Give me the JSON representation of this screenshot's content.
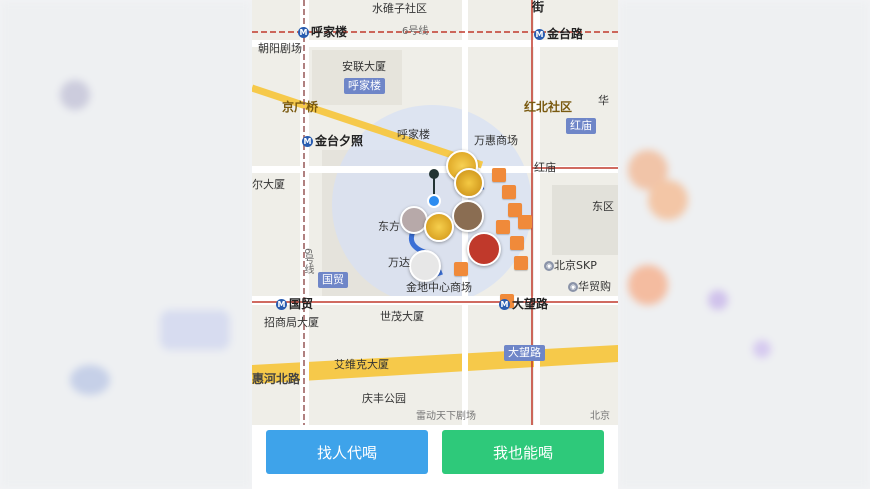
{
  "map": {
    "road_labels": {
      "line6": "6号线",
      "jie": "街",
      "line6_vertical": "6号线",
      "dawang_road_tag": "大望路"
    },
    "stations": {
      "hujialou": "呼家楼",
      "jintai_road": "金台路",
      "jintai_xizhao": "金台夕照",
      "guomao": "国贸",
      "dawang_road": "大望路",
      "honghmiao": "红庙"
    },
    "areas": {
      "shuidui": "水碓子社区",
      "chaoyang_theatre": "朝阳剧场",
      "anlian": "安联大厦",
      "hujialou_tag": "呼家楼",
      "jingguangqiao": "京广桥",
      "hongbei": "红北社区",
      "hua": "华",
      "hujialou_poi": "呼家楼",
      "wanhui": "万惠商场",
      "honghmiao_tag": "红庙",
      "ershang": "尔大厦",
      "dongqu": "东区",
      "dongfang": "东方",
      "wanda": "万达",
      "guomao_tag": "国贸",
      "jindi": "金地中心商场",
      "beijing_skp": "北京SKP",
      "huamao": "华贸购",
      "zhaoshang": "招商局大厦",
      "shimao": "世茂大厦",
      "aiweike": "艾维克大厦",
      "tonghe_road": "惠河北路",
      "qingfeng": "庆丰公园",
      "beijing": "北京",
      "lei": "雷动天下剧场"
    }
  },
  "buttons": {
    "find_label": "找人代喝",
    "me_label": "我也能喝"
  },
  "colors": {
    "find_button": "#3ea3ea",
    "me_button": "#2ec97a",
    "road": "#f6c94a",
    "metro_line": "#c0392b",
    "map_bg": "#efeee8"
  }
}
